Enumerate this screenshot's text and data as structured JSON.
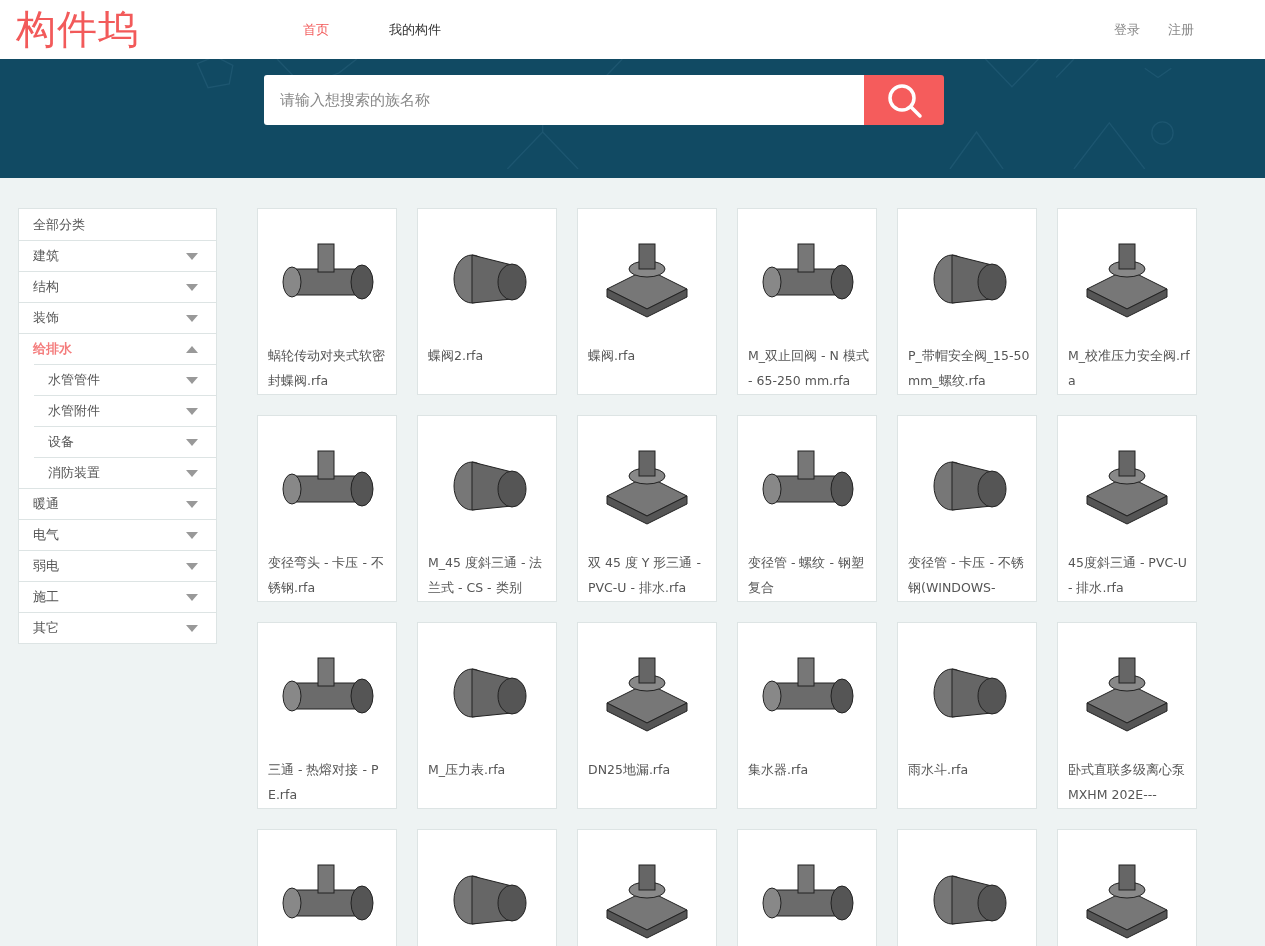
{
  "header": {
    "logo": "构件坞",
    "nav": [
      {
        "label": "首页",
        "selected": true
      },
      {
        "label": "我的构件",
        "selected": false
      }
    ],
    "account": [
      "登录",
      "注册"
    ]
  },
  "search": {
    "placeholder": "请输入想搜索的族名称"
  },
  "sidebar": {
    "all_label": "全部分类",
    "items": [
      {
        "label": "建筑",
        "selected": false,
        "expanded": false
      },
      {
        "label": "结构",
        "selected": false,
        "expanded": false
      },
      {
        "label": "装饰",
        "selected": false,
        "expanded": false
      },
      {
        "label": "给排水",
        "selected": true,
        "expanded": true,
        "children": [
          {
            "label": "水管管件",
            "selected": false,
            "expanded": false
          },
          {
            "label": "水管附件",
            "selected": false,
            "expanded": false
          },
          {
            "label": "设备",
            "selected": false,
            "expanded": false
          },
          {
            "label": "消防装置",
            "selected": false,
            "expanded": false
          }
        ]
      },
      {
        "label": "暖通",
        "selected": false,
        "expanded": false
      },
      {
        "label": "电气",
        "selected": false,
        "expanded": false
      },
      {
        "label": "弱电",
        "selected": false,
        "expanded": false
      },
      {
        "label": "施工",
        "selected": false,
        "expanded": false
      },
      {
        "label": "其它",
        "selected": false,
        "expanded": false
      }
    ]
  },
  "products": [
    {
      "kind": "captioned",
      "name": "蜗轮传动对夹式软密封蝶阀.rfa"
    },
    {
      "kind": "captioned",
      "name": "蝶阀2.rfa"
    },
    {
      "kind": "captioned",
      "name": "蝶阀.rfa"
    },
    {
      "kind": "captioned",
      "name": "M_双止回阀 - N 模式 - 65-250 mm.rfa"
    },
    {
      "kind": "captioned",
      "name": "P_带帽安全阀_15-50 mm_螺纹.rfa"
    },
    {
      "kind": "captioned",
      "name": "M_校准压力安全阀.rfa"
    },
    {
      "kind": "captioned",
      "name": "变径弯头 - 卡压 - 不锈钢.rfa"
    },
    {
      "kind": "captioned",
      "name": "M_45 度斜三通 - 法兰式 - CS - 类别"
    },
    {
      "kind": "captioned",
      "name": "双 45 度 Y 形三通 - PVC-U - 排水.rfa"
    },
    {
      "kind": "captioned",
      "name": "变径管 - 螺纹 - 钢塑复合"
    },
    {
      "kind": "captioned",
      "name": "变径管 - 卡压 - 不锈钢(WINDOWS-"
    },
    {
      "kind": "captioned",
      "name": "45度斜三通 - PVC-U - 排水.rfa"
    },
    {
      "kind": "captioned",
      "name": "三通 - 热熔对接 - PE.rfa"
    },
    {
      "kind": "captioned",
      "name": "M_压力表.rfa"
    },
    {
      "kind": "captioned",
      "name": "DN25地漏.rfa"
    },
    {
      "kind": "captioned",
      "name": "集水器.rfa"
    },
    {
      "kind": "captioned",
      "name": "雨水斗.rfa"
    },
    {
      "kind": "captioned",
      "name": "卧式直联多级离心泵 MXHM 202E---"
    },
    {
      "kind": "image-only"
    },
    {
      "kind": "image-only"
    },
    {
      "kind": "image-only"
    },
    {
      "kind": "image-only"
    },
    {
      "kind": "image-only"
    },
    {
      "kind": "image-only"
    }
  ]
}
